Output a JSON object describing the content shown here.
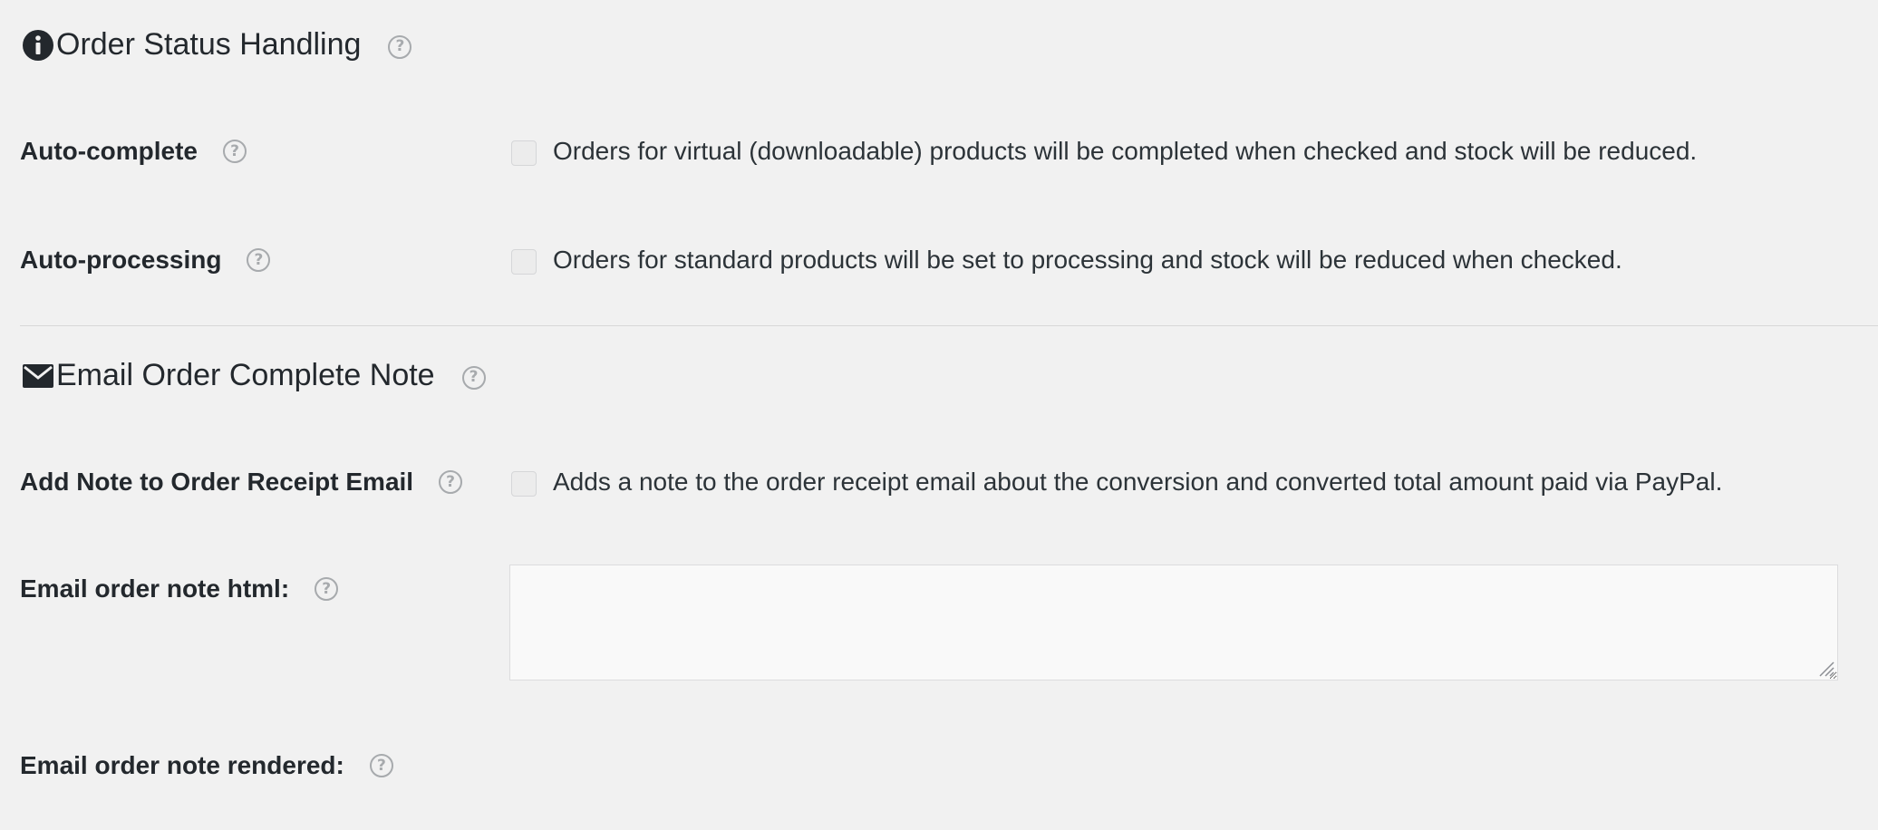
{
  "sections": {
    "order_status": {
      "title": "Order Status Handling",
      "icon": "info-icon"
    },
    "email_note": {
      "title": "Email Order Complete Note",
      "icon": "envelope-icon"
    }
  },
  "help_glyph": "?",
  "rows": {
    "auto_complete": {
      "label": "Auto-complete",
      "checked": false,
      "description": "Orders for virtual (downloadable) products will be completed when checked and stock will be reduced."
    },
    "auto_processing": {
      "label": "Auto-processing",
      "checked": false,
      "description": "Orders for standard products will be set to processing and stock will be reduced when checked."
    },
    "add_note": {
      "label": "Add Note to Order Receipt Email",
      "checked": false,
      "description": "Adds a note to the order receipt email about the conversion and converted total amount paid via PayPal."
    },
    "note_html": {
      "label": "Email order note html:",
      "value": ""
    },
    "note_rendered": {
      "label": "Email order note rendered:"
    }
  },
  "colors": {
    "background": "#f1f1f1",
    "text": "#23282d",
    "help_icon": "#a7aaad",
    "divider": "#d8d8d8"
  }
}
